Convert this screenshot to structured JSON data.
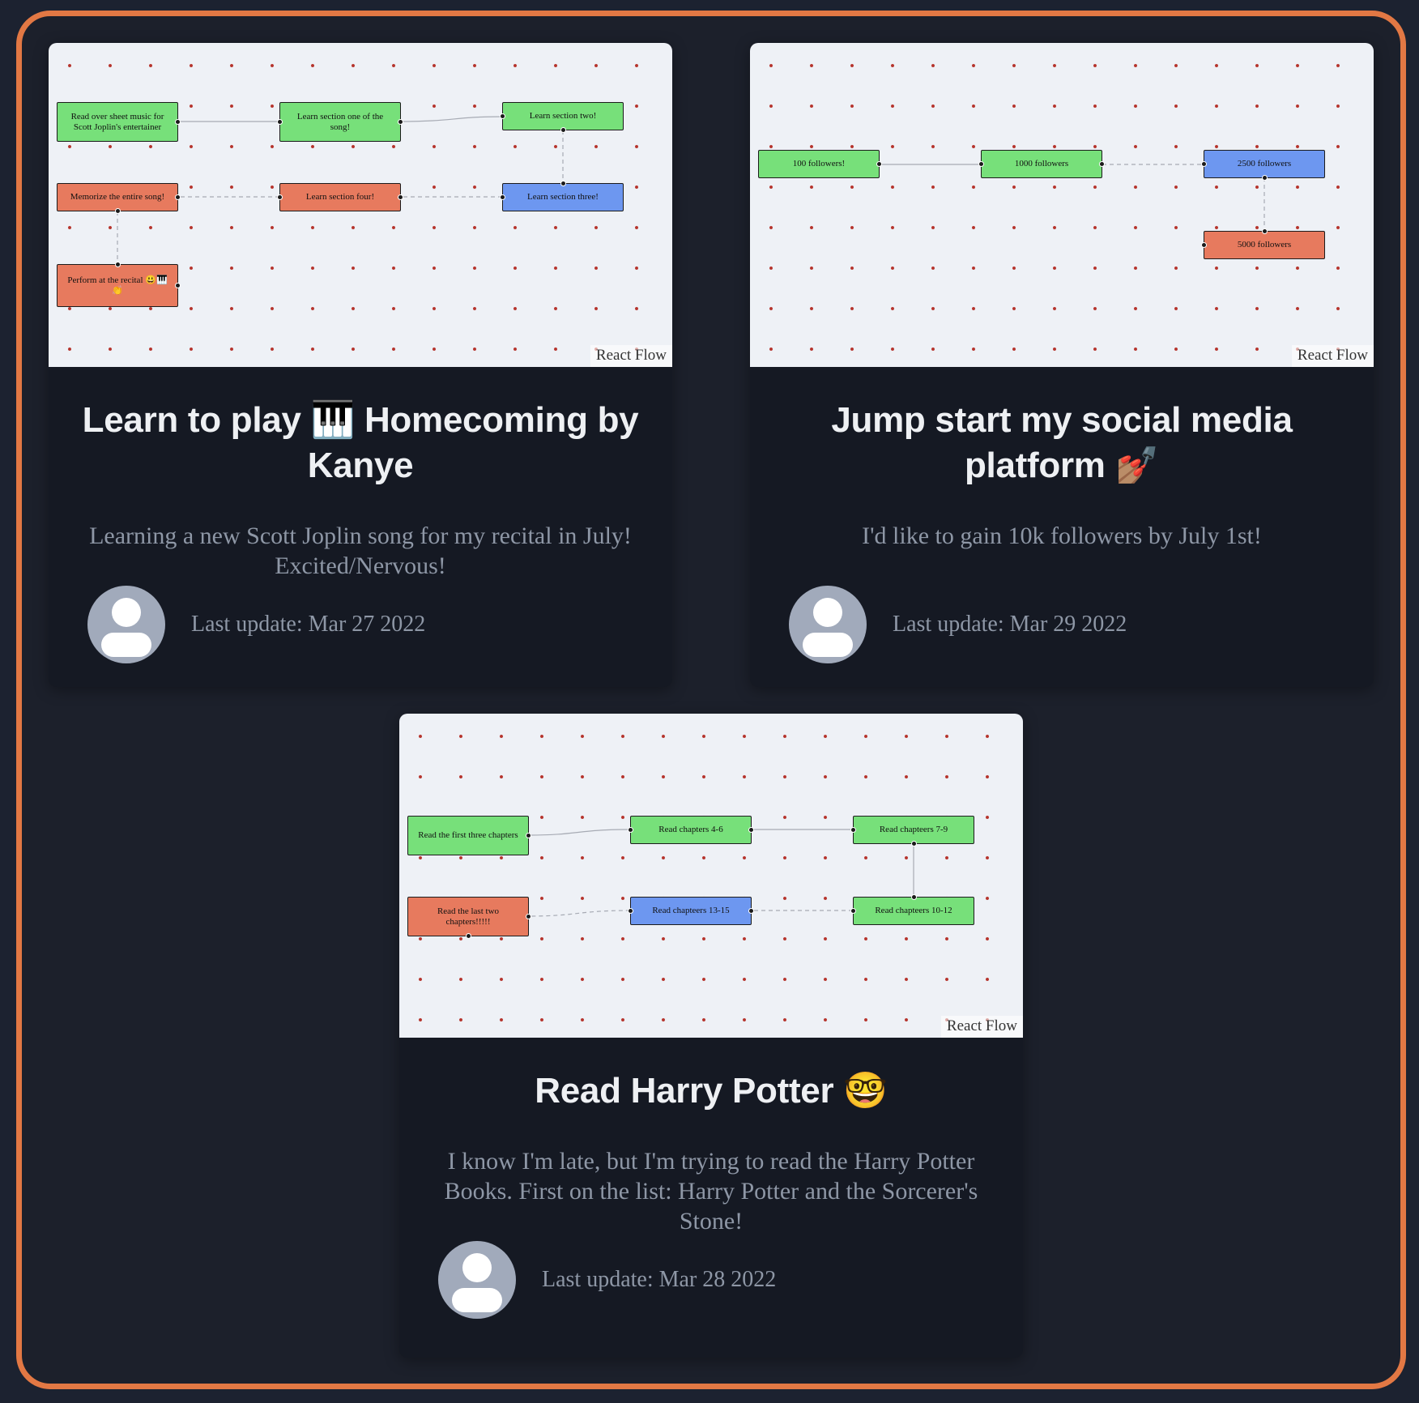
{
  "cards": [
    {
      "title": "Learn to play 🎹 Homecoming by Kanye",
      "description": "Learning a new Scott Joplin song for my recital in July! Excited/Nervous!",
      "last_update": "Last update: Mar 27 2022",
      "attribution": "React Flow",
      "nodes": [
        {
          "label": "Read over sheet music for Scott Joplin's entertainer",
          "status": "green"
        },
        {
          "label": "Learn section one of the song!",
          "status": "green"
        },
        {
          "label": "Learn section two!",
          "status": "green"
        },
        {
          "label": "Memorize the entire song!",
          "status": "red"
        },
        {
          "label": "Learn section four!",
          "status": "red"
        },
        {
          "label": "Learn section three!",
          "status": "blue"
        },
        {
          "label": "Perform at the recital 😃🎹👏",
          "status": "red"
        }
      ]
    },
    {
      "title": "Jump start my social media platform 💅🏽",
      "description": "I'd like to gain 10k followers by July 1st!",
      "last_update": "Last update: Mar 29 2022",
      "attribution": "React Flow",
      "nodes": [
        {
          "label": "100 followers!",
          "status": "green"
        },
        {
          "label": "1000 followers",
          "status": "green"
        },
        {
          "label": "2500 followers",
          "status": "blue"
        },
        {
          "label": "5000 followers",
          "status": "red"
        }
      ]
    },
    {
      "title": "Read Harry Potter 🤓",
      "description": "I know I'm late, but I'm trying to read the Harry Potter Books. First on the list: Harry Potter and the Sorcerer's Stone!",
      "last_update": "Last update: Mar 28 2022",
      "attribution": "React Flow",
      "nodes": [
        {
          "label": "Read the first three chapters",
          "status": "green"
        },
        {
          "label": "Read chapters 4-6",
          "status": "green"
        },
        {
          "label": "Read chapteers 7-9",
          "status": "green"
        },
        {
          "label": "Read the last two chapters!!!!!",
          "status": "red"
        },
        {
          "label": "Read chapteers 13-15",
          "status": "blue"
        },
        {
          "label": "Read chapteers 10-12",
          "status": "green"
        }
      ]
    }
  ],
  "colors": {
    "accent_border": "#e27844",
    "node_done": "#77e07a",
    "node_todo": "#e77a5e",
    "node_in_progress": "#6d97f0",
    "canvas_dot": "#b5332b"
  }
}
